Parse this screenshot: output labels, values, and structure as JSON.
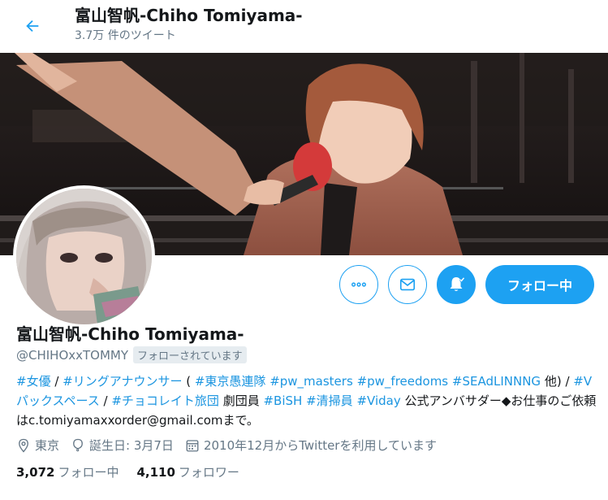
{
  "header": {
    "title": "富山智帆-Chiho Tomiyama-",
    "tweet_count": "3.7万 件のツイート"
  },
  "profile": {
    "name": "富山智帆-Chiho Tomiyama-",
    "handle": "@CHIHOxxTOMMY",
    "follows_you": "フォローされています",
    "bio": [
      {
        "t": "#女優",
        "link": true
      },
      {
        "t": " / ",
        "link": false
      },
      {
        "t": "#リングアナウンサー",
        "link": true
      },
      {
        "t": " ( ",
        "link": false
      },
      {
        "t": "#東京愚連隊",
        "link": true
      },
      {
        "t": " ",
        "link": false
      },
      {
        "t": "#pw_masters",
        "link": true
      },
      {
        "t": " ",
        "link": false
      },
      {
        "t": "#pw_freedoms",
        "link": true
      },
      {
        "t": " ",
        "link": false
      },
      {
        "t": "#SEAdLINNNG",
        "link": true
      },
      {
        "t": " 他) / ",
        "link": false
      },
      {
        "t": "#Vパックスペース",
        "link": true
      },
      {
        "t": " / ",
        "link": false
      },
      {
        "t": "#チョコレイト旅団",
        "link": true
      },
      {
        "t": " 劇団員 ",
        "link": false
      },
      {
        "t": "#BiSH",
        "link": true
      },
      {
        "t": " ",
        "link": false
      },
      {
        "t": "#清掃員",
        "link": true
      },
      {
        "t": " ",
        "link": false
      },
      {
        "t": "#Viday",
        "link": true
      },
      {
        "t": " 公式アンバサダー◆お仕事のご依頼はc.tomiyamaxxorder@gmail.comまで。",
        "link": false
      }
    ],
    "location": "東京",
    "birthday": "誕生日: 3月7日",
    "joined": "2010年12月からTwitterを利用しています",
    "following_count": "3,072",
    "following_label": "フォロー中",
    "followers_count": "4,110",
    "followers_label": "フォロワー"
  },
  "actions": {
    "follow_label": "フォロー中",
    "more_icon": "more-icon",
    "message_icon": "envelope-icon",
    "notify_icon": "bell-icon"
  },
  "colors": {
    "accent": "#1da1f2",
    "link": "#1b95e0",
    "muted": "#657786"
  }
}
